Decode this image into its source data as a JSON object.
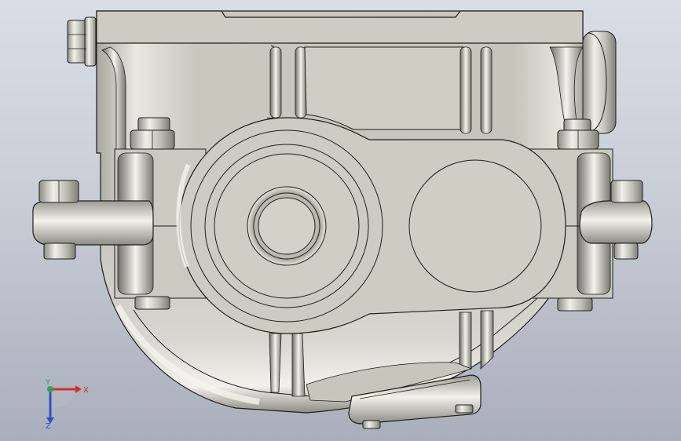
{
  "viewport": {
    "background_top": "#d9dee6",
    "background_bottom": "#a9afbb"
  },
  "model": {
    "part_color": "#c9c8bf",
    "edge_color": "#1e1e1e",
    "shadow_color": "#8d8c83",
    "highlight_color": "#eeeee6"
  },
  "triad": {
    "x_label": "X",
    "y_label": "Y",
    "z_label": "Z",
    "x_color": "#d03030",
    "y_color": "#2fa84a",
    "z_color": "#3050c0"
  }
}
